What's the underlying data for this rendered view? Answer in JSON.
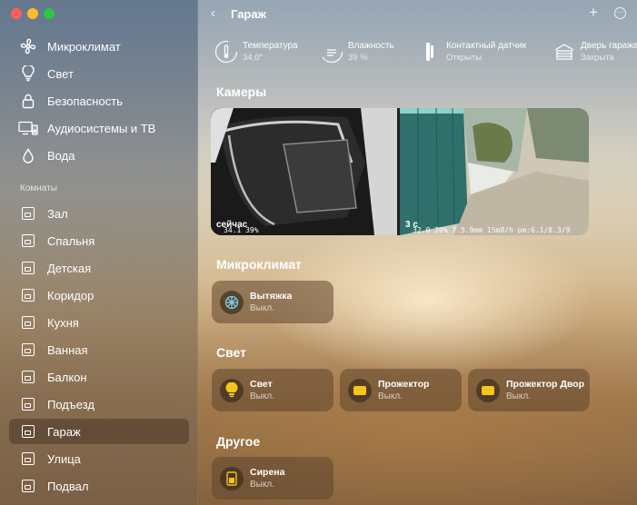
{
  "window": {
    "title": "Гараж"
  },
  "sidebar": {
    "categories": [
      {
        "label": "Микроклимат",
        "icon": "fan-icon"
      },
      {
        "label": "Свет",
        "icon": "lightbulb-icon"
      },
      {
        "label": "Безопасность",
        "icon": "lock-icon"
      },
      {
        "label": "Аудиосистемы и ТВ",
        "icon": "tv-speaker-icon"
      },
      {
        "label": "Вода",
        "icon": "water-drop-icon"
      }
    ],
    "rooms_label": "Комнаты",
    "rooms": [
      {
        "label": "Зал"
      },
      {
        "label": "Спальня"
      },
      {
        "label": "Детская"
      },
      {
        "label": "Коридор"
      },
      {
        "label": "Кухня"
      },
      {
        "label": "Ванная"
      },
      {
        "label": "Балкон"
      },
      {
        "label": "Подъезд"
      },
      {
        "label": "Гараж",
        "selected": true
      },
      {
        "label": "Улица"
      },
      {
        "label": "Подвал"
      }
    ]
  },
  "status": [
    {
      "name": "Температура",
      "value": "34,0°",
      "icon": "thermometer-icon"
    },
    {
      "name": "Влажность",
      "value": "39 %",
      "icon": "humidity-icon"
    },
    {
      "name": "Контактный датчик",
      "value": "Открыты",
      "icon": "contact-sensor-icon"
    },
    {
      "name": "Дверь гаража",
      "value": "Закрыта",
      "icon": "garage-door-icon"
    }
  ],
  "sections": {
    "cameras": "Камеры",
    "climate": "Микроклимат",
    "light": "Свет",
    "other": "Другое"
  },
  "cameras": [
    {
      "label": "сейчас",
      "overlay": "34.1 39%"
    },
    {
      "label": "3 с",
      "overlay": "32.0 20% 7.5.9mm 15m8/h pm:6.1/8.3/9"
    }
  ],
  "climate_tiles": [
    {
      "name": "Вытяжка",
      "value": "Выкл.",
      "icon": "fan-icon"
    }
  ],
  "light_tiles": [
    {
      "name": "Свет",
      "value": "Выкл.",
      "icon": "lightbulb-icon"
    },
    {
      "name": "Прожектор",
      "value": "Выкл.",
      "icon": "floodlight-icon"
    },
    {
      "name": "Прожектор Двор",
      "value": "Выкл.",
      "icon": "floodlight-icon"
    }
  ],
  "other_tiles": [
    {
      "name": "Сирена",
      "value": "Выкл.",
      "icon": "siren-icon"
    }
  ],
  "colors": {
    "accent": "#f5c518",
    "selected_bg": "#3c2d1e"
  }
}
